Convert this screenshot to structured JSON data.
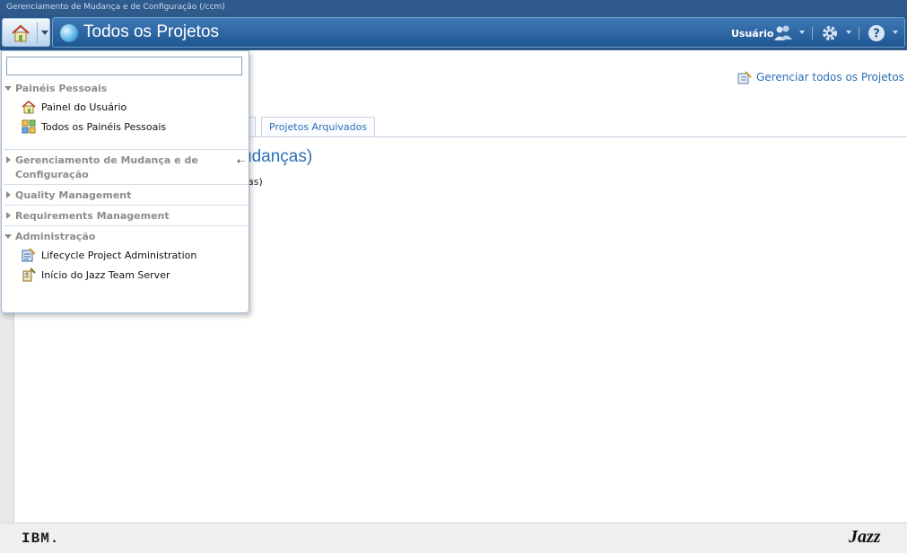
{
  "app": {
    "window_title": "Gerenciamento de Mudança e de Configuração (/ccm)",
    "page_title": "Todos os Projetos",
    "user_label": "Usuário"
  },
  "main": {
    "manage_link": "Gerenciar todos os Projetos",
    "tab_archived": "Projetos Arquivados",
    "section_heading_partial": "udanças)",
    "section_sub_partial": "as)"
  },
  "popup": {
    "search_value": "",
    "groups": [
      {
        "label": "Painéis Pessoais",
        "expanded": true,
        "items": [
          {
            "label": "Painel do Usuário",
            "icon": "house-icon"
          },
          {
            "label": "Todos os Painéis Pessoais",
            "icon": "dashboards-icon"
          }
        ]
      },
      {
        "label": "Gerenciamento de Mudança e de",
        "label_line2": "Configuração",
        "expanded": false,
        "items": []
      },
      {
        "label": "Quality Management",
        "expanded": false,
        "items": []
      },
      {
        "label": "Requirements Management",
        "expanded": false,
        "items": []
      },
      {
        "label": "Administração",
        "expanded": true,
        "items": [
          {
            "label": "Lifecycle Project Administration",
            "icon": "project-admin-icon"
          },
          {
            "label": "Início do Jazz Team Server",
            "icon": "server-admin-icon"
          }
        ]
      }
    ]
  },
  "footer": {
    "ibm": "IBM.",
    "jazz": "Jazz"
  },
  "colors": {
    "banner": "#2f5b8c",
    "navbar": "#2a5688",
    "link": "#2d6fb6",
    "group_header": "#8c8c8c"
  }
}
